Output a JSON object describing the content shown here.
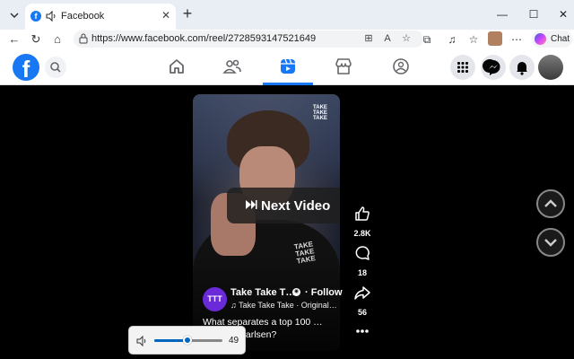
{
  "browser": {
    "tab": {
      "title": "Facebook",
      "favicon": "facebook-favicon"
    },
    "address": {
      "url": "https://www.facebook.com/reel/2728593147521649"
    },
    "copilot_label": "Chat"
  },
  "facebook": {
    "brand_color": "#1877f2",
    "nav": [
      "home-icon",
      "friends-icon",
      "reels-icon",
      "marketplace-icon",
      "groups-icon"
    ],
    "active_nav": "reels-icon"
  },
  "reel": {
    "watermark": "TAKE TAKE TAKE",
    "shirt_logo": "TAKE TAKE TAKE",
    "next_video_label": "Next Video",
    "creator": {
      "avatar_text": "TTT",
      "name": "Take Take T…",
      "follow_label": "· Follow",
      "audio": "♫ Take Take Take · Original…"
    },
    "caption": "What separates a top 100 … Magnus Carlsen?",
    "actions": {
      "likes": "2.8K",
      "comments": "18",
      "shares": "56"
    }
  },
  "volume": {
    "value": "49",
    "level_percent": 49
  }
}
